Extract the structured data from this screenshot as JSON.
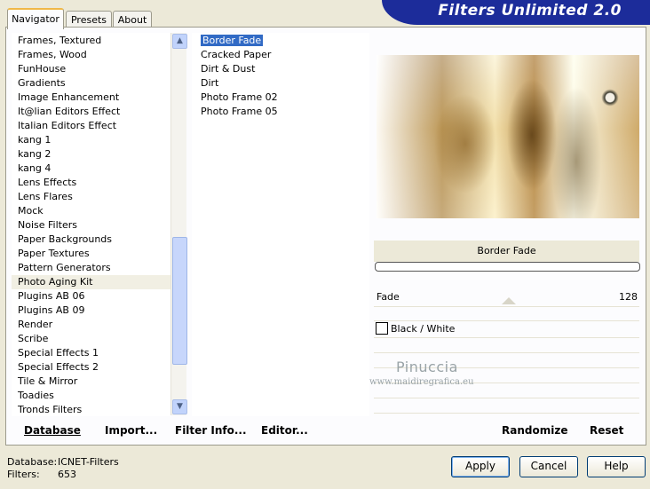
{
  "app_title": "Filters Unlimited 2.0",
  "tabs": [
    {
      "label": "Navigator"
    },
    {
      "label": "Presets"
    },
    {
      "label": "About"
    }
  ],
  "categories": [
    "Frames, Textured",
    "Frames, Wood",
    "FunHouse",
    "Gradients",
    "Image Enhancement",
    "It@lian Editors Effect",
    "Italian Editors Effect",
    "kang 1",
    "kang 2",
    "kang 4",
    "Lens Effects",
    "Lens Flares",
    "Mock",
    "Noise Filters",
    "Paper Backgrounds",
    "Paper Textures",
    "Pattern Generators",
    "Photo Aging Kit",
    "Plugins AB 06",
    "Plugins AB 09",
    "Render",
    "Scribe",
    "Special Effects 1",
    "Special Effects 2",
    "Tile & Mirror",
    "Toadies",
    "Tronds Filters"
  ],
  "selected_category": "Photo Aging Kit",
  "filters": [
    "Border Fade",
    "Cracked Paper",
    "Dirt & Dust",
    "Dirt",
    "Photo Frame 02",
    "Photo Frame 05"
  ],
  "selected_filter": "Border Fade",
  "filter_title": "Border Fade",
  "params": {
    "fade_label": "Fade",
    "fade_value": "128",
    "bw_label": "Black / White"
  },
  "watermark": {
    "line1": "Pinuccia",
    "line2": "www.maidiregrafica.eu"
  },
  "bottom_buttons": {
    "database": "Database",
    "import": "Import...",
    "filter_info": "Filter Info...",
    "editor": "Editor...",
    "randomize": "Randomize",
    "reset": "Reset"
  },
  "status": {
    "database_label": "Database:",
    "database_value": "ICNET-Filters",
    "filters_label": "Filters:",
    "filters_value": "653"
  },
  "dialog_buttons": {
    "apply": "Apply",
    "cancel": "Cancel",
    "help": "Help"
  }
}
